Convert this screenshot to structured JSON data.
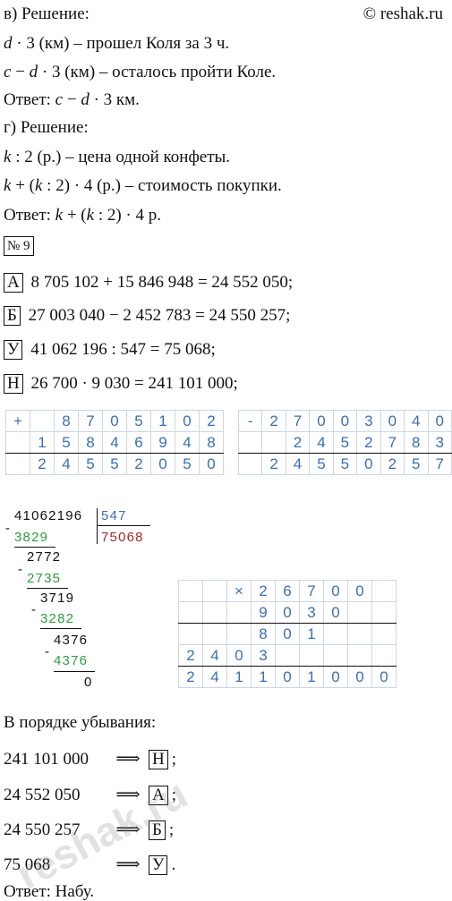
{
  "source": "© reshak.ru",
  "part_v": {
    "header": "в) Решение:",
    "line1": "· 3 (км) – прошел Коля за 3 ч.",
    "line1_var": "d",
    "line2_var1": "c",
    "line2_mid": " − ",
    "line2_var2": "d",
    "line2_rest": " · 3 (км) – осталось пройти Коле.",
    "answer_label": "Ответ: ",
    "answer_var1": "c",
    "answer_mid": " − ",
    "answer_var2": "d",
    "answer_rest": " · 3 км."
  },
  "part_g": {
    "header": "г) Решение:",
    "l1_var": "k",
    "l1_rest": " : 2 (р.) – цена одной конфеты.",
    "l2_var1": "k",
    "l2_a": " + (",
    "l2_var2": "k",
    "l2_rest": " : 2) · 4 (р.) – стоимость покупки.",
    "answer_label": "Ответ: ",
    "a_var1": "k",
    "a_a": " + (",
    "a_var2": "k",
    "a_rest": " : 2) · 4 р."
  },
  "task_number": "№ 9",
  "equations": [
    {
      "letter": "А",
      "text": "8 705 102 + 15 846 948 = 24 552 050;"
    },
    {
      "letter": "Б",
      "text": "27 003 040 − 2 452 783 = 24 550 257;"
    },
    {
      "letter": "У",
      "text": "41 062 196 : 547 = 75 068;"
    },
    {
      "letter": "Н",
      "text": "26 700 · 9 030 = 241 101 000;"
    }
  ],
  "add_table": {
    "op": "+",
    "row1": [
      "",
      "",
      "8",
      "7",
      "0",
      "5",
      "1",
      "0",
      "2"
    ],
    "row2": [
      "",
      "1",
      "5",
      "8",
      "4",
      "6",
      "9",
      "4",
      "8"
    ],
    "row3": [
      "",
      "2",
      "4",
      "5",
      "5",
      "2",
      "0",
      "5",
      "0"
    ]
  },
  "sub_table": {
    "op": "-",
    "row1": [
      "",
      "2",
      "7",
      "0",
      "0",
      "3",
      "0",
      "4",
      "0"
    ],
    "row2": [
      "",
      "",
      "2",
      "4",
      "5",
      "2",
      "7",
      "8",
      "3"
    ],
    "row3": [
      "",
      "2",
      "4",
      "5",
      "5",
      "0",
      "2",
      "5",
      "7"
    ]
  },
  "division": {
    "dividend": "41062196",
    "divisor": "547",
    "quotient": "75068",
    "steps": [
      "3829",
      "2772",
      "2735",
      "3719",
      "3282",
      "4376",
      "4376",
      "0"
    ],
    "minus": "-"
  },
  "mul_table": {
    "op": "×",
    "row1": [
      "",
      "",
      "",
      "2",
      "6",
      "7",
      "0",
      "0",
      ""
    ],
    "row2": [
      "",
      "",
      "",
      "9",
      "0",
      "3",
      "0",
      "",
      ""
    ],
    "row3": [
      "",
      "",
      "",
      "8",
      "0",
      "1",
      "",
      "",
      ""
    ],
    "row4": [
      "2",
      "4",
      "0",
      "3",
      "",
      "",
      "",
      "",
      ""
    ],
    "row5": [
      "2",
      "4",
      "1",
      "1",
      "0",
      "1",
      "0",
      "0",
      "0"
    ]
  },
  "order": {
    "header": "В порядке убывания:",
    "arrow": "⟹",
    "items": [
      {
        "value": "241 101 000",
        "letter": "Н",
        "end": ";"
      },
      {
        "value": "24 552 050",
        "letter": "А",
        "end": ";"
      },
      {
        "value": "24 550 257",
        "letter": "Б",
        "end": ";"
      },
      {
        "value": "75 068",
        "letter": "У",
        "end": "."
      }
    ],
    "answer": "Ответ: Набу."
  },
  "watermark": "reshak.ru"
}
